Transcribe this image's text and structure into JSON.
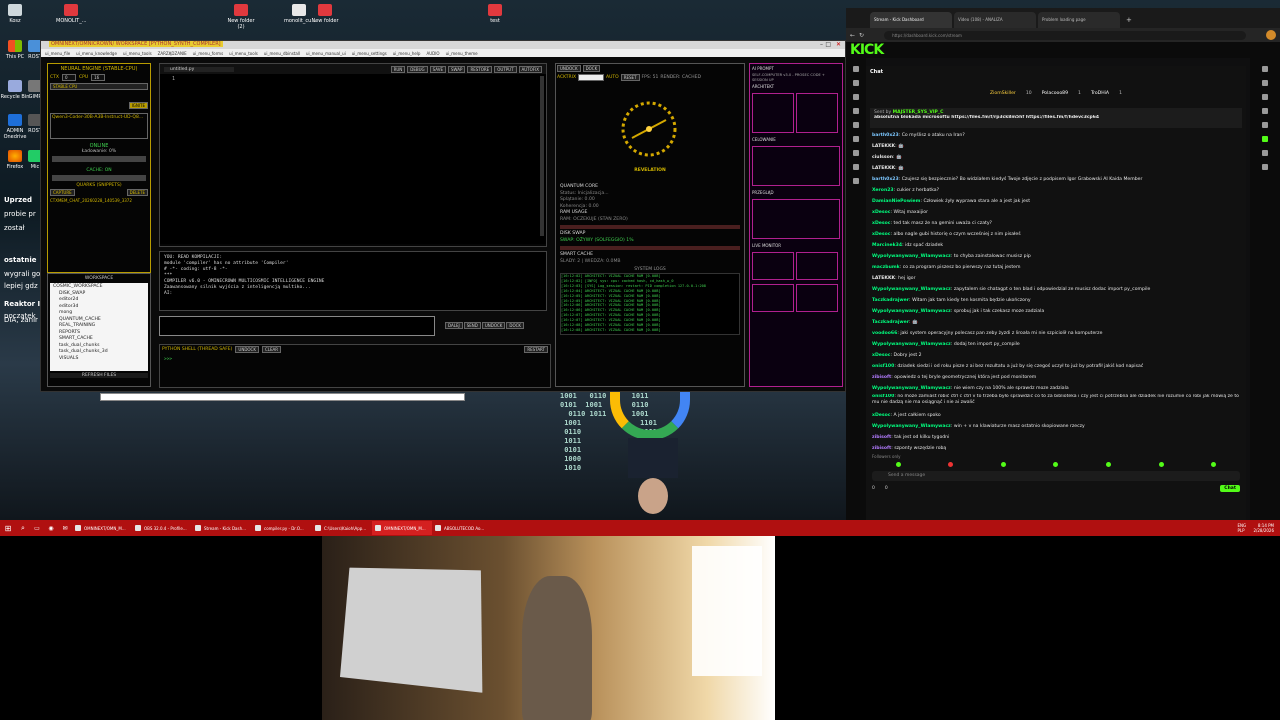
{
  "desktop": {
    "icons": [
      {
        "label": "Kosz"
      },
      {
        "label": "MONOLIT_..."
      },
      {
        "label": "New folder (2)"
      },
      {
        "label": "monolit_cu..."
      },
      {
        "label": "New folder"
      },
      {
        "label": "test"
      }
    ],
    "left_icons": [
      {
        "label": "This PC"
      },
      {
        "label": "ROST"
      },
      {
        "label": "Recycle Bin"
      },
      {
        "label": "GIMP"
      },
      {
        "label": "ADMIN Onedrive"
      },
      {
        "label": "ROST"
      },
      {
        "label": "Firefox"
      },
      {
        "label": "Mic"
      }
    ],
    "left_chat_fragments": [
      "Uprzed",
      "probie pr",
      "został",
      "ostatnie",
      "wygrali go",
      "lepiej gdz",
      "Reaktor I",
      "DIA, zanir",
      "początek"
    ],
    "taskbar_clock": "8:14 PM",
    "taskbar_date": "2/28/2026",
    "taskbar_lang": "ENG PLP"
  },
  "app": {
    "title": "OMNINEXT/OMNICROWN/ WORKSPACE [PYTHON_SYNTH_COMPILER]",
    "menu": [
      "ui_menu_file",
      "ui_menu_knowledge",
      "ui_menu_tools",
      "ZARZĄDZANIE",
      "ui_menu_forms",
      "ui_menu_tools",
      "ui_menu_dbinstall",
      "ui_menu_manual_ui",
      "ui_menu_settings",
      "ui_menu_help",
      "AUDIO",
      "ui_menu_theme"
    ],
    "neural": {
      "header": "NEURAL ENGINE (STABLE-CPU)",
      "ctx_label": "CTX",
      "ctx_value": "0",
      "cpu_label": "CPU",
      "cpu_value": "16",
      "stable_btn": "STABLE CPU",
      "ignite_btn": "IGNITE",
      "model": "Qwen3-Coder-30B-A3B-Instruct-UD-Q8...",
      "status": "ONLINE",
      "loading": "Ładowanie: 0%",
      "cache": "CACHE: ON",
      "quarks": "QUARKS (SNIPPETS)",
      "capture": "CAPTURE",
      "delete": "DELETE",
      "quark_item": "CTXMEM_CHAT_20260228_140539_3372"
    },
    "workspace": {
      "header": "WORKSPACE",
      "tree": [
        "COSMIC_WORKSPACE",
        "DISK_SWAP",
        "editor2d",
        "editor3d",
        "mong",
        "QUANTUM_CACHE",
        "REAL_TRAINING",
        "REPORTS",
        "SMART_CACHE",
        "task_dual_chunks",
        "task_dual_chunks_3d",
        "VISUALS"
      ],
      "refresh": "REFRESH FILES"
    },
    "editor": {
      "tab": "untitled.py",
      "line": "1",
      "buttons": [
        "RUN",
        "DEBUG",
        "SAVE",
        "SWAP",
        "RESTORE",
        "OUTPUT",
        "AUTOFIX"
      ]
    },
    "console": {
      "lines": [
        "YOU: READ KOMPILACJI:",
        "module 'compiler' has no attribute 'Compiler'",
        "# -*- coding: utf-8 -*-",
        "***",
        "COMPILER v6.0 - OMINECROWN MULTICOSMIC INTELLIGENCE ENGINE",
        "Zaawansowany silnik wyjścia z inteligencją multiko...",
        "AI:"
      ]
    },
    "input": {
      "send_buttons": [
        "DALEJ",
        "SEND",
        "UNDOCK",
        "DOCK"
      ]
    },
    "shell": {
      "header": "PYTHON SHELL (THREAD SAFE)",
      "buttons": [
        "UNDOCK",
        "CLEAR"
      ],
      "restart": "RESTART",
      "prompt": ">>>"
    },
    "revelation": {
      "top_buttons": [
        "UNDOCK",
        "DOCK"
      ],
      "actrix": "ACKTRIX",
      "auto": "AUTO",
      "reset": "RESET",
      "fps": "FPS: 51",
      "render": "RENDER: CACHED",
      "label": "REVELATION",
      "quantum_core": "QUANTUM CORE",
      "status": "Status: Inicjalizacja...",
      "splatanie": "Splątanie: 0.00",
      "koherencja": "Koherencja: 0.00",
      "ram": "RAM USAGE",
      "ram_status": "RAM: OCZEKUJE (STAN ZERO)",
      "disk": "DISK SWAP",
      "swap": "SWAP: OŻYWY (SOLFEGGIO) 1%",
      "smart_cache": "SMART CACHE",
      "slady": "ŚLADY: 2 | WIEDZA: 0.0MB",
      "system_logs": "SYSTEM LOGS",
      "logs": [
        "[16:12:02] ARCHITECT: VIZUAL CACHE RAM [0.00B]",
        "[16:12:02] [INFO] sys: cpu: cached hash, cd_hash_w_0",
        "[16:12:03] [SYS] Log_session: restart: PID completion 127.0.0.1:208",
        "[16:12:04] ARCHITECT: VIZUAL CACHE RAM [0.00B]",
        "[16:12:05] ARCHITECT: VIZUAL CACHE RAM [0.00B]",
        "[16:12:05] ARCHITECT: VIZUAL CACHE RAM [0.00B]",
        "[16:12:06] ARCHITECT: VIZUAL CACHE RAM [0.00B]",
        "[16:12:06] ARCHITECT: VIZUAL CACHE RAM [0.00B]",
        "[16:12:07] ARCHITECT: VIZUAL CACHE RAM [0.00B]",
        "[16:12:07] ARCHITECT: VIZUAL CACHE RAM [0.00B]",
        "[16:12:08] ARCHITECT: VIZUAL CACHE RAM [0.00B]",
        "[16:12:08] ARCHITECT: VIZUAL CACHE RAM [0.00B]"
      ]
    },
    "side": {
      "title": "AI PROMPT",
      "sub": "SELF-COMPUTER v3.0 - PROSEC CODE + SESSION UP",
      "architect": "ARCHITEKT",
      "caption1": "CELOWANIE",
      "caption2": "PRZEGLĄD",
      "caption3": "LIVE MONITOR"
    }
  },
  "browser": {
    "tabs": [
      {
        "label": "Stream - Kick Dashboard"
      },
      {
        "label": "Video (108) - ANALIZA"
      },
      {
        "label": "Problem loading page"
      }
    ],
    "url": "https://dashboard.kick.com/stream",
    "logo": "KICK",
    "chat_title": "Chat",
    "top_users": [
      {
        "name": "ZiomSkiller",
        "count": "10"
      },
      {
        "name": "Polacooo89",
        "count": "1"
      },
      {
        "name": "TroDHiA",
        "count": "1"
      }
    ],
    "pinned": {
      "sent_by": "Sent by",
      "sender": "MAJSTER_SYS_VIP_C",
      "text": "absolutna blokada microsoftu https://files.fm/f/rp3ck8m5hf https://files.fm/f/hdevc3cp64"
    },
    "messages": [
      {
        "user": "barth0x23",
        "text": "Co myślisz o ataku na Iran?",
        "color": "#7cc7ff"
      },
      {
        "user": "LATEKKK",
        "text": "🤖",
        "color": "#ffffff"
      },
      {
        "user": "ciulsson",
        "text": "🤖",
        "color": "#ffffff"
      },
      {
        "user": "LATEKKK",
        "text": "🤖",
        "color": "#ffffff"
      },
      {
        "user": "barth0x23",
        "text": "Czujesz się bezpiecznie? Bo widziałem kiedyś Twoje zdjęcie z podpisem Igor Grabowski AI Kaida Member",
        "color": "#7cc7ff"
      },
      {
        "user": "Xeron23",
        "text": "cukier z herbatka?",
        "color": "#00ff7f"
      },
      {
        "user": "DamianNiePowiem",
        "text": "Człowiek żyły wyprawa stara ale a jest jak jest",
        "color": "#00ff7f"
      },
      {
        "user": "xDesoc",
        "text": "Witaj maxaijior",
        "color": "#00ff7f"
      },
      {
        "user": "xDesoc",
        "text": "ted tak masz że na gemini uważa ci czaty?",
        "color": "#00ff7f"
      },
      {
        "user": "xDesoc",
        "text": "albo nagle gubi historię o czym wcześniej z nim pisałeś",
        "color": "#00ff7f"
      },
      {
        "user": "Marcinek34",
        "text": "idz spać dziadek",
        "color": "#00ff7f"
      },
      {
        "user": "Wypolywanywany_Wlamywacz",
        "text": "to chyba zainstalowac musisz pip",
        "color": "#00ff7f"
      },
      {
        "user": "maczbumk",
        "text": "co za program piszesz bo pierwszy raz tutaj jestem",
        "color": "#00ff7f"
      },
      {
        "user": "LATEKKK",
        "text": "hej igor",
        "color": "#ffffff"
      },
      {
        "user": "Wypolywanywany_Wlamywacz",
        "text": "zapytalem sie chatagpt o ten blad i odpowiedzial ze musisz dodac import py_compile",
        "color": "#00ff7f"
      },
      {
        "user": "Taczkadrajwer",
        "text": "Witam jak tam kiedy ten kosmita będzie ukończony",
        "color": "#00ff7f"
      },
      {
        "user": "Wypolywanywany_Wlamywacz",
        "text": "sprobuj jak i tak czekasz moze zadziala",
        "color": "#00ff7f"
      },
      {
        "user": "Taczkadrajwer",
        "text": "🤖",
        "color": "#00ff7f"
      },
      {
        "user": "voodoo66",
        "text": "jaki system operacyjny polecasz pan zeby żyzdi z liroała mi nie szpiciolił na komputerze",
        "color": "#00ff7f"
      },
      {
        "user": "Wypolywanywany_Wlamywacz",
        "text": "dodaj ten import py_compile",
        "color": "#00ff7f"
      },
      {
        "user": "xDesoc",
        "text": "Dobry jest 2",
        "color": "#00ff7f"
      },
      {
        "user": "onisf100",
        "text": "dziadek siedzi i od roku pisze z ai bez rezultatu a już by się czegoś uczył to już by potrafił jakiś kod napisać",
        "color": "#00ff7f"
      },
      {
        "user": "zibisoft",
        "text": "opowiedz o tej bryle geometrycznej która jest pod monitorem",
        "color": "#b37cff"
      },
      {
        "user": "Wypolywanywany_Wlamywacz",
        "text": "nie wiem czy na 100% ale sprawdz moze zadziala",
        "color": "#00ff7f"
      },
      {
        "user": "onisf100",
        "text": "no może zamiast robić ctrl c ctrl v to trzeba było sprawdzić co to za biblioteka i czy jest ci potrzebna ale dziadek nie rozumie co robi jak mówią że to mu nie dadzą nie ma osiągnąć i nie ai zwalić",
        "color": "#00ff7f"
      },
      {
        "user": "xDesoc",
        "text": "A jest całkiem spoko",
        "color": "#00ff7f"
      },
      {
        "user": "Wypolywanywany_Wlamywacz",
        "text": "win + v na klawiaturze masz ostatnio skopiowane rzeczy",
        "color": "#00ff7f"
      },
      {
        "user": "zibisoft",
        "text": "tak jest od kilku tygodni",
        "color": "#b37cff"
      },
      {
        "user": "zibisoft",
        "text": "szponty wszędzie robą",
        "color": "#b37cff"
      }
    ],
    "followers_only": "Followers only",
    "send_placeholder": "Send a message",
    "chat_btn": "Chat",
    "count_a": "0",
    "count_b": "0"
  },
  "taskbar": {
    "apps": [
      "OMNINEXT/OMN_M...",
      "OBS 32.0.4 - Profile...",
      "Stream - Kick Dash...",
      "compiler.py - Dr.O...",
      "C:\\Users\\Kaioh\\App...",
      "OMNINEXT/OMN_M...",
      "ABSOLUTECOD Ao..."
    ]
  }
}
